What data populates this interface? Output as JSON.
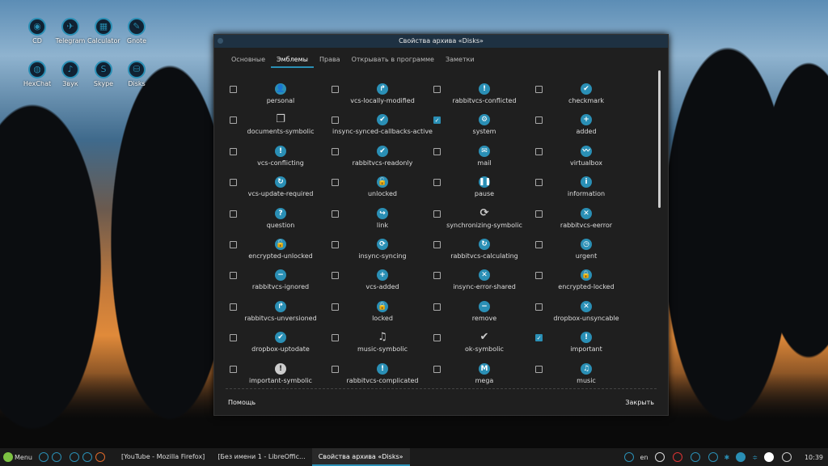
{
  "desktop": {
    "icons": [
      {
        "label": "CD",
        "glyph": "◉"
      },
      {
        "label": "Telegram",
        "glyph": "✈"
      },
      {
        "label": "Calculator",
        "glyph": "▦"
      },
      {
        "label": "Gnote",
        "glyph": "✎"
      },
      {
        "label": "HexChat",
        "glyph": "◍"
      },
      {
        "label": "Звук",
        "glyph": "♪"
      },
      {
        "label": "Skype",
        "glyph": "S"
      },
      {
        "label": "Disks",
        "glyph": "⛁"
      }
    ]
  },
  "dialog": {
    "title": "Свойства архива «Disks»",
    "tabs": [
      {
        "label": "Основные"
      },
      {
        "label": "Эмблемы",
        "active": true
      },
      {
        "label": "Права"
      },
      {
        "label": "Открывать в программе"
      },
      {
        "label": "Заметки"
      }
    ],
    "emblems": [
      {
        "name": "personal",
        "icon": "👤",
        "checked": false
      },
      {
        "name": "vcs-locally-modified",
        "icon": "↱",
        "checked": false
      },
      {
        "name": "rabbitvcs-conflicted",
        "icon": "!",
        "checked": false
      },
      {
        "name": "checkmark",
        "icon": "✔",
        "checked": false
      },
      {
        "name": "documents-symbolic",
        "icon": "❐",
        "checked": false,
        "style": "plain"
      },
      {
        "name": "insync-synced-callbacks-active",
        "icon": "✔",
        "checked": false
      },
      {
        "name": "system",
        "icon": "⚙",
        "checked": true
      },
      {
        "name": "added",
        "icon": "+",
        "checked": false
      },
      {
        "name": "vcs-conflicting",
        "icon": "!",
        "checked": false
      },
      {
        "name": "rabbitvcs-readonly",
        "icon": "✔",
        "checked": false
      },
      {
        "name": "mail",
        "icon": "✉",
        "checked": false
      },
      {
        "name": "virtualbox",
        "icon": "〰",
        "checked": false
      },
      {
        "name": "vcs-update-required",
        "icon": "↻",
        "checked": false
      },
      {
        "name": "unlocked",
        "icon": "🔓",
        "checked": false
      },
      {
        "name": "pause",
        "icon": "❚❚",
        "checked": false
      },
      {
        "name": "information",
        "icon": "i",
        "checked": false
      },
      {
        "name": "question",
        "icon": "?",
        "checked": false
      },
      {
        "name": "link",
        "icon": "↪",
        "checked": false
      },
      {
        "name": "synchronizing-symbolic",
        "icon": "⟳",
        "checked": false,
        "style": "plain"
      },
      {
        "name": "rabbitvcs-eerror",
        "icon": "✕",
        "checked": false
      },
      {
        "name": "encrypted-unlocked",
        "icon": "🔓",
        "checked": false
      },
      {
        "name": "insync-syncing",
        "icon": "⟳",
        "checked": false
      },
      {
        "name": "rabbitvcs-calculating",
        "icon": "↻",
        "checked": false
      },
      {
        "name": "urgent",
        "icon": "◷",
        "checked": false
      },
      {
        "name": "rabbitvcs-ignored",
        "icon": "−",
        "checked": false
      },
      {
        "name": "vcs-added",
        "icon": "+",
        "checked": false
      },
      {
        "name": "insync-error-shared",
        "icon": "✕",
        "checked": false
      },
      {
        "name": "encrypted-locked",
        "icon": "🔒",
        "checked": false
      },
      {
        "name": "rabbitvcs-unversioned",
        "icon": "↱",
        "checked": false
      },
      {
        "name": "locked",
        "icon": "🔒",
        "checked": false
      },
      {
        "name": "remove",
        "icon": "−",
        "checked": false
      },
      {
        "name": "dropbox-unsyncable",
        "icon": "✕",
        "checked": false
      },
      {
        "name": "dropbox-uptodate",
        "icon": "✔",
        "checked": false
      },
      {
        "name": "music-symbolic",
        "icon": "♫",
        "checked": false,
        "style": "plain"
      },
      {
        "name": "ok-symbolic",
        "icon": "✔",
        "checked": false,
        "style": "plain"
      },
      {
        "name": "important",
        "icon": "!",
        "checked": true
      },
      {
        "name": "important-symbolic",
        "icon": "!",
        "checked": false,
        "style": "grey"
      },
      {
        "name": "rabbitvcs-complicated",
        "icon": "!",
        "checked": false
      },
      {
        "name": "mega",
        "icon": "M",
        "checked": false
      },
      {
        "name": "music",
        "icon": "♫",
        "checked": false
      }
    ],
    "help_label": "Помощь",
    "close_label": "Закрыть"
  },
  "taskbar": {
    "menu_label": "Menu",
    "tasks": [
      {
        "label": "[YouTube - Mozilla Firefox]"
      },
      {
        "label": "[Без имени 1 - LibreOffic..."
      },
      {
        "label": "Свойства архива «Disks»",
        "active": true
      }
    ],
    "lang": "en",
    "clock": "10:39"
  },
  "colors": {
    "accent": "#2a8fb5"
  }
}
